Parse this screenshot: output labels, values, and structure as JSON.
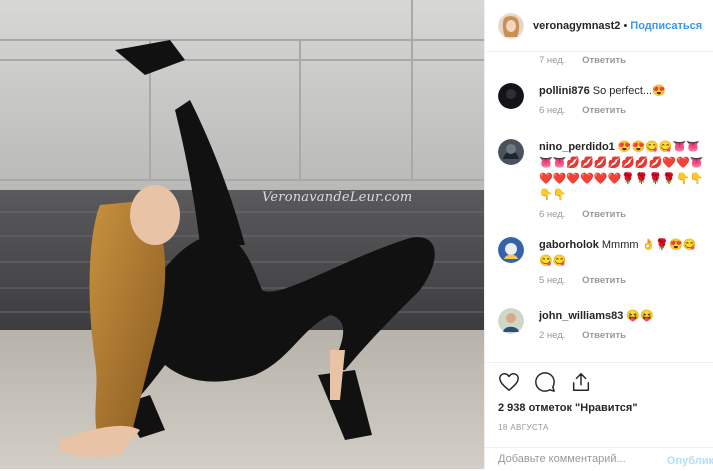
{
  "photo": {
    "watermark": "VeronavandeLeur.com"
  },
  "header": {
    "username": "veronagymnast2",
    "separator": "•",
    "follow_label": "Подписаться"
  },
  "top_meta": {
    "time": "7 нед.",
    "reply": "Ответить"
  },
  "comments": [
    {
      "user": "pollini876",
      "text": "So perfect...😍",
      "time": "6 нед.",
      "reply": "Ответить"
    },
    {
      "user": "nino_perdido1",
      "text": "😍😍😋😋👅👅👅👅💋💋💋💋💋💋💋❤️❤️👅❤️❤️❤️❤️❤️❤️🌹🌹🌹🌹👇👇👇👇",
      "time": "6 нед.",
      "reply": "Ответить"
    },
    {
      "user": "gaborholok",
      "text": "Mmmm 👌🌹😍😋😋😋",
      "time": "5 нед.",
      "reply": "Ответить"
    },
    {
      "user": "john_williams83",
      "text": "😝😝",
      "time": "2 нед.",
      "reply": "Ответить"
    }
  ],
  "actions": {
    "icons": [
      "heart-icon",
      "comment-icon",
      "share-icon"
    ],
    "likes": "2 938 отметок \"Нравится\"",
    "date": "18 АВГУСТА"
  },
  "add_comment": {
    "placeholder": "Добавьте комментарий...",
    "publish_label": "Опублик"
  },
  "colors": {
    "link": "#3897f0",
    "muted": "#999999",
    "text": "#262626",
    "publish_disabled": "#b2dffc"
  }
}
